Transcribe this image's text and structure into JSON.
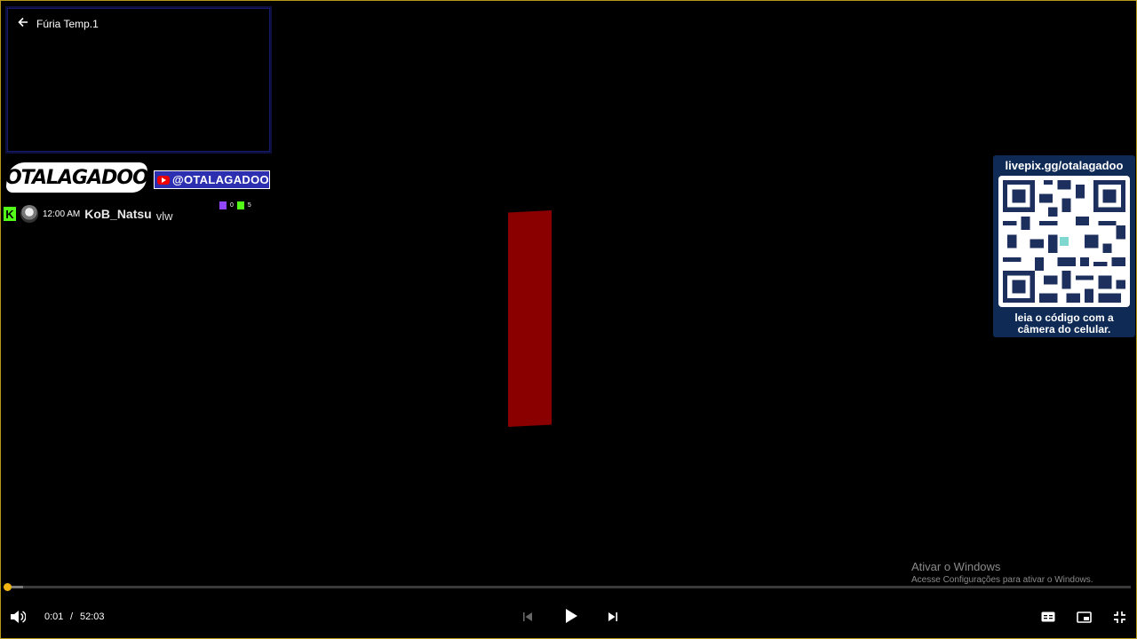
{
  "player": {
    "back_title": "Fúria Temp.1",
    "current_time": "0:01",
    "separator": "/",
    "duration": "52:03",
    "progress_fraction": 0.0003,
    "buffer_fraction": 0.015,
    "accent_color": "#e1a70f"
  },
  "overlay": {
    "logo_text": "OTALAGADOO",
    "handle": "@OTALAGADOO",
    "chat": {
      "time": "12:00 AM",
      "user": "KoB_Natsu",
      "message": "vlw"
    },
    "viewers": {
      "twitch_count": "0",
      "kick_count": "5"
    },
    "qr": {
      "url": "livepix.gg/otalagadoo",
      "caption_line1": "leia o código com a",
      "caption_line2": "câmera do celular."
    }
  },
  "watermark": {
    "title": "Ativar o Windows",
    "subtitle": "Acesse Configurações para ativar o Windows."
  },
  "icons": {
    "back": "arrow-left-icon",
    "volume": "volume-icon",
    "prev": "skip-previous-icon",
    "play": "play-icon",
    "next": "skip-next-icon",
    "subtitles": "subtitles-icon",
    "pip": "picture-in-picture-icon",
    "exit_fullscreen": "exit-fullscreen-icon"
  }
}
